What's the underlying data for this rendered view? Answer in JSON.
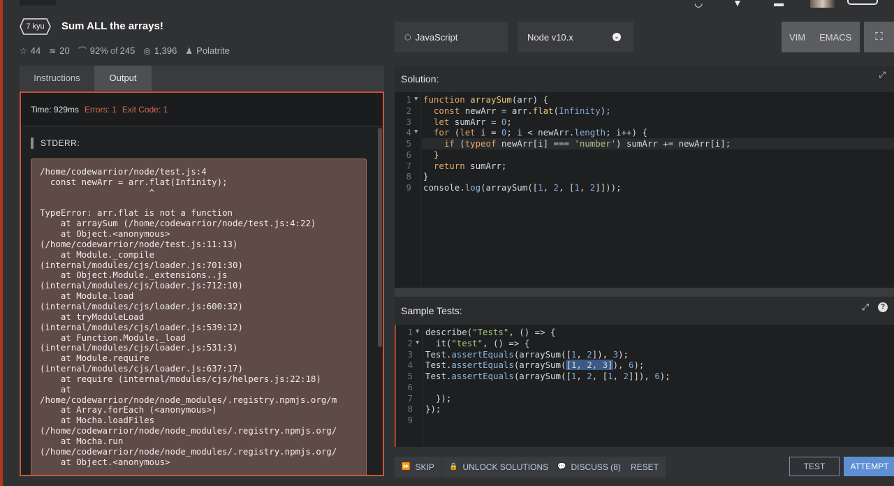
{
  "kata": {
    "rank": "7 kyu",
    "title": "Sum ALL the arrays!",
    "stars": "44",
    "collections": "20",
    "satisfaction": "92%",
    "of_label": "of",
    "votes": "245",
    "completions": "1,396",
    "author": "Polatrite"
  },
  "toolbar": {
    "language": "JavaScript",
    "runtime": "Node v10.x",
    "vim": "VIM",
    "emacs": "EMACS"
  },
  "tabs": {
    "instructions": "Instructions",
    "output": "Output"
  },
  "output": {
    "time": "Time: 929ms",
    "errors": "Errors: 1",
    "exit_code": "Exit Code: 1",
    "stderr_label": "STDERR:",
    "stderr_text": "/home/codewarrior/node/test.js:4\n  const newArr = arr.flat(Infinity);\n                     ^\n\nTypeError: arr.flat is not a function\n    at arraySum (/home/codewarrior/node/test.js:4:22)\n    at Object.<anonymous>\n(/home/codewarrior/node/test.js:11:13)\n    at Module._compile\n(internal/modules/cjs/loader.js:701:30)\n    at Object.Module._extensions..js\n(internal/modules/cjs/loader.js:712:10)\n    at Module.load\n(internal/modules/cjs/loader.js:600:32)\n    at tryModuleLoad\n(internal/modules/cjs/loader.js:539:12)\n    at Function.Module._load\n(internal/modules/cjs/loader.js:531:3)\n    at Module.require\n(internal/modules/cjs/loader.js:637:17)\n    at require (internal/modules/cjs/helpers.js:22:18)\n    at\n/home/codewarrior/node/node_modules/.registry.npmjs.org/m\n    at Array.forEach (<anonymous>)\n    at Mocha.loadFiles\n(/home/codewarrior/node/node_modules/.registry.npmjs.org/\n    at Mocha.run\n(/home/codewarrior/node/node_modules/.registry.npmjs.org/\n    at Object.<anonymous>"
  },
  "solution": {
    "label": "Solution:",
    "lines": [
      {
        "n": "1",
        "fold": true,
        "tokens": [
          [
            "k",
            "function "
          ],
          [
            "f",
            "arraySum"
          ],
          [
            "p",
            "(arr) {"
          ]
        ]
      },
      {
        "n": "2",
        "fold": false,
        "tokens": [
          [
            "p",
            "  "
          ],
          [
            "k",
            "const "
          ],
          [
            "p",
            "newArr = arr."
          ],
          [
            "f",
            "flat"
          ],
          [
            "p",
            "("
          ],
          [
            "n",
            "Infinity"
          ],
          [
            "p",
            ");"
          ]
        ]
      },
      {
        "n": "3",
        "fold": false,
        "tokens": [
          [
            "p",
            "  "
          ],
          [
            "k",
            "let "
          ],
          [
            "p",
            "sumArr = "
          ],
          [
            "n",
            "0"
          ],
          [
            "p",
            ";"
          ]
        ]
      },
      {
        "n": "4",
        "fold": true,
        "tokens": [
          [
            "p",
            "  "
          ],
          [
            "k",
            "for "
          ],
          [
            "p",
            "("
          ],
          [
            "k",
            "let "
          ],
          [
            "p",
            "i = "
          ],
          [
            "n",
            "0"
          ],
          [
            "p",
            "; i < newArr."
          ],
          [
            "m",
            "length"
          ],
          [
            "p",
            "; i++) {"
          ]
        ]
      },
      {
        "n": "5",
        "fold": false,
        "tokens": [
          [
            "p",
            "    "
          ],
          [
            "k",
            "if "
          ],
          [
            "p",
            "("
          ],
          [
            "k",
            "typeof "
          ],
          [
            "p",
            "newArr[i] === "
          ],
          [
            "s",
            "'number'"
          ],
          [
            "p",
            ") sumArr += newArr[i];"
          ]
        ]
      },
      {
        "n": "6",
        "fold": false,
        "tokens": [
          [
            "p",
            "  }"
          ]
        ]
      },
      {
        "n": "7",
        "fold": false,
        "tokens": [
          [
            "p",
            "  "
          ],
          [
            "k",
            "return "
          ],
          [
            "p",
            "sumArr;"
          ]
        ]
      },
      {
        "n": "8",
        "fold": false,
        "tokens": [
          [
            "p",
            "}"
          ]
        ]
      },
      {
        "n": "9",
        "fold": false,
        "tokens": [
          [
            "p",
            "console."
          ],
          [
            "m",
            "log"
          ],
          [
            "p",
            "(arraySum(["
          ],
          [
            "n",
            "1"
          ],
          [
            "p",
            ", "
          ],
          [
            "n",
            "2"
          ],
          [
            "p",
            ", ["
          ],
          [
            "n",
            "1"
          ],
          [
            "p",
            ", "
          ],
          [
            "n",
            "2"
          ],
          [
            "p",
            "]]));"
          ]
        ]
      }
    ]
  },
  "tests": {
    "label": "Sample Tests:",
    "lines": [
      {
        "n": "1",
        "fold": true,
        "tokens": [
          [
            "p",
            "describe("
          ],
          [
            "s",
            "\"Tests\""
          ],
          [
            "p",
            ", () => {"
          ]
        ]
      },
      {
        "n": "2",
        "fold": true,
        "tokens": [
          [
            "p",
            "  it("
          ],
          [
            "s",
            "\"test\""
          ],
          [
            "p",
            ", () => {"
          ]
        ]
      },
      {
        "n": "3",
        "fold": false,
        "tokens": [
          [
            "p",
            "Test."
          ],
          [
            "m",
            "assertEquals"
          ],
          [
            "p",
            "(arraySum(["
          ],
          [
            "n",
            "1"
          ],
          [
            "p",
            ", "
          ],
          [
            "n",
            "2"
          ],
          [
            "p",
            "]), "
          ],
          [
            "n",
            "3"
          ],
          [
            "p",
            ");"
          ]
        ]
      },
      {
        "n": "4",
        "fold": false,
        "tokens": [
          [
            "p",
            "Test."
          ],
          [
            "m",
            "assertEquals"
          ],
          [
            "p",
            "(arraySum("
          ],
          [
            "sel",
            "[1, 2, 3]"
          ],
          [
            "p",
            "), "
          ],
          [
            "n",
            "6"
          ],
          [
            "p",
            ");"
          ]
        ]
      },
      {
        "n": "5",
        "fold": false,
        "tokens": [
          [
            "p",
            "Test."
          ],
          [
            "m",
            "assertEquals"
          ],
          [
            "p",
            "(arraySum(["
          ],
          [
            "n",
            "1"
          ],
          [
            "p",
            ", "
          ],
          [
            "n",
            "2"
          ],
          [
            "p",
            ", ["
          ],
          [
            "n",
            "1"
          ],
          [
            "p",
            ", "
          ],
          [
            "n",
            "2"
          ],
          [
            "p",
            "]]), "
          ],
          [
            "n",
            "6"
          ],
          [
            "p",
            ");"
          ]
        ]
      },
      {
        "n": "6",
        "fold": false,
        "tokens": [
          [
            "p",
            ""
          ]
        ]
      },
      {
        "n": "7",
        "fold": false,
        "tokens": [
          [
            "p",
            "  });"
          ]
        ]
      },
      {
        "n": "8",
        "fold": false,
        "tokens": [
          [
            "p",
            "});"
          ]
        ]
      },
      {
        "n": "9",
        "fold": false,
        "tokens": [
          [
            "p",
            ""
          ]
        ]
      }
    ]
  },
  "actions": {
    "skip": "SKIP",
    "unlock": "UNLOCK SOLUTIONS",
    "discuss": "DISCUSS (8)",
    "reset": "RESET",
    "test": "TEST",
    "attempt": "ATTEMPT"
  },
  "icons": {
    "star": "star-icon",
    "collection": "stack-icon",
    "satisfaction": "rainbow-icon",
    "completions": "target-icon",
    "author": "person-icon"
  }
}
